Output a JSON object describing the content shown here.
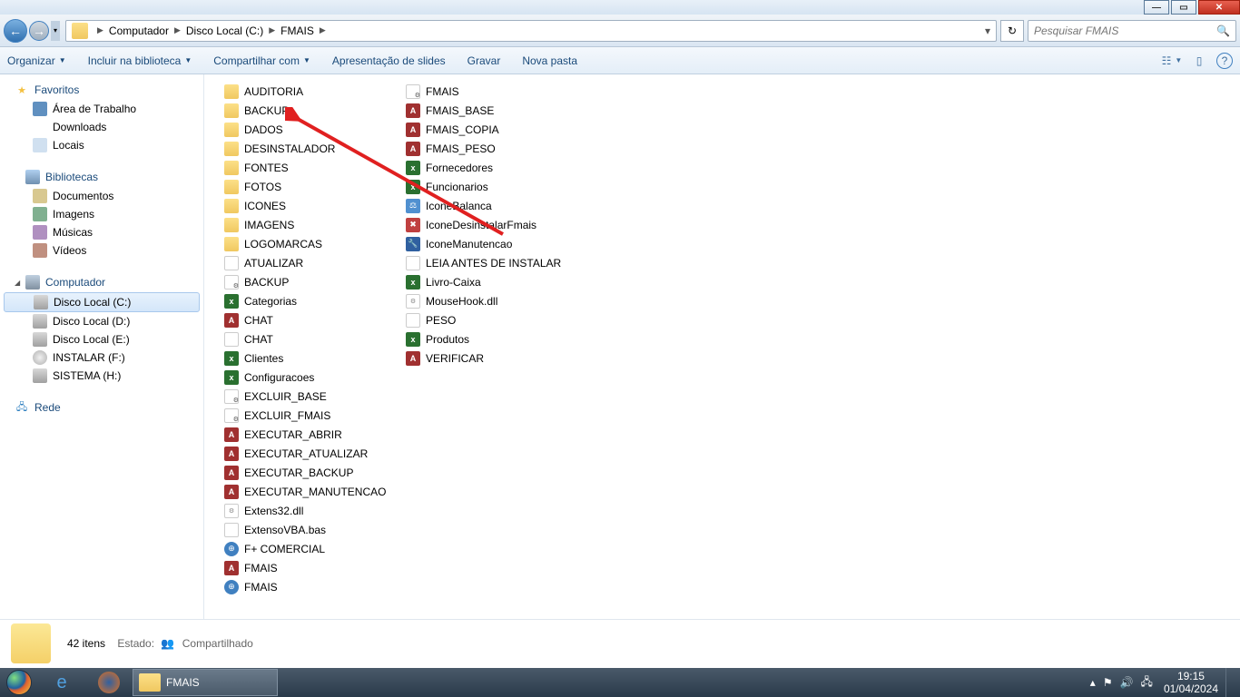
{
  "window": {
    "min": "—",
    "max": "▭",
    "close": "✕"
  },
  "breadcrumb": {
    "items": [
      "Computador",
      "Disco Local (C:)",
      "FMAIS"
    ],
    "drop": "▾",
    "refresh": "↻"
  },
  "search": {
    "placeholder": "Pesquisar FMAIS",
    "icon": "🔍"
  },
  "toolbar": {
    "organizar": "Organizar",
    "incluir": "Incluir na biblioteca",
    "compartilhar": "Compartilhar com",
    "apresentacao": "Apresentação de slides",
    "gravar": "Gravar",
    "novapasta": "Nova pasta",
    "view": "☷",
    "preview": "▯",
    "help": "?"
  },
  "sidebar": {
    "favoritos": {
      "label": "Favoritos",
      "items": [
        {
          "label": "Área de Trabalho",
          "ic": "ic-desk"
        },
        {
          "label": "Downloads",
          "ic": "ic-dl"
        },
        {
          "label": "Locais",
          "ic": "ic-loc"
        }
      ]
    },
    "bibliotecas": {
      "label": "Bibliotecas",
      "items": [
        {
          "label": "Documentos",
          "ic": "ic-doc"
        },
        {
          "label": "Imagens",
          "ic": "ic-img"
        },
        {
          "label": "Músicas",
          "ic": "ic-mus"
        },
        {
          "label": "Vídeos",
          "ic": "ic-vid"
        }
      ]
    },
    "computador": {
      "label": "Computador",
      "items": [
        {
          "label": "Disco Local (C:)",
          "ic": "ic-hdd",
          "sel": true
        },
        {
          "label": "Disco Local (D:)",
          "ic": "ic-hdd"
        },
        {
          "label": "Disco Local (E:)",
          "ic": "ic-hdd"
        },
        {
          "label": "INSTALAR (F:)",
          "ic": "ic-cd"
        },
        {
          "label": "SISTEMA (H:)",
          "ic": "ic-hdd"
        }
      ]
    },
    "rede": {
      "label": "Rede"
    }
  },
  "files": {
    "col1": [
      {
        "n": "AUDITORIA",
        "t": "f-folder"
      },
      {
        "n": "BACKUP",
        "t": "f-folder"
      },
      {
        "n": "DADOS",
        "t": "f-folder"
      },
      {
        "n": "DESINSTALADOR",
        "t": "f-folder"
      },
      {
        "n": "FONTES",
        "t": "f-folder"
      },
      {
        "n": "FOTOS",
        "t": "f-folder"
      },
      {
        "n": "ICONES",
        "t": "f-folder"
      },
      {
        "n": "IMAGENS",
        "t": "f-folder"
      },
      {
        "n": "LOGOMARCAS",
        "t": "f-folder"
      },
      {
        "n": "ATUALIZAR",
        "t": "f-txt"
      },
      {
        "n": "BACKUP",
        "t": "f-bat"
      },
      {
        "n": "Categorias",
        "t": "f-xls",
        "l": "x"
      },
      {
        "n": "CHAT",
        "t": "f-acc",
        "l": "A"
      },
      {
        "n": "CHAT",
        "t": "f-txt"
      },
      {
        "n": "Clientes",
        "t": "f-xls",
        "l": "x"
      },
      {
        "n": "Configuracoes",
        "t": "f-xls",
        "l": "x"
      },
      {
        "n": "EXCLUIR_BASE",
        "t": "f-bat"
      },
      {
        "n": "EXCLUIR_FMAIS",
        "t": "f-bat"
      },
      {
        "n": "EXECUTAR_ABRIR",
        "t": "f-acc",
        "l": "A"
      },
      {
        "n": "EXECUTAR_ATUALIZAR",
        "t": "f-acc",
        "l": "A"
      },
      {
        "n": "EXECUTAR_BACKUP",
        "t": "f-acc",
        "l": "A"
      },
      {
        "n": "EXECUTAR_MANUTENCAO",
        "t": "f-acc",
        "l": "A"
      },
      {
        "n": "Extens32.dll",
        "t": "f-dll"
      },
      {
        "n": "ExtensoVBA.bas",
        "t": "f-txt"
      },
      {
        "n": "F+ COMERCIAL",
        "t": "f-app",
        "l": "⊕"
      },
      {
        "n": "FMAIS",
        "t": "f-acc",
        "l": "A"
      },
      {
        "n": "FMAIS",
        "t": "f-app",
        "l": "⊕"
      }
    ],
    "col2": [
      {
        "n": "FMAIS",
        "t": "f-bat"
      },
      {
        "n": "FMAIS_BASE",
        "t": "f-acc",
        "l": "A"
      },
      {
        "n": "FMAIS_COPIA",
        "t": "f-acc",
        "l": "A"
      },
      {
        "n": "FMAIS_PESO",
        "t": "f-acc",
        "l": "A"
      },
      {
        "n": "Fornecedores",
        "t": "f-xls",
        "l": "x"
      },
      {
        "n": "Funcionarios",
        "t": "f-xls",
        "l": "x"
      },
      {
        "n": "IconeBalanca",
        "t": "f-bal",
        "l": "⚖"
      },
      {
        "n": "IconeDesinstalarFmais",
        "t": "f-uni",
        "l": "✖"
      },
      {
        "n": "IconeManutencao",
        "t": "f-mnt",
        "l": "🔧"
      },
      {
        "n": "LEIA ANTES DE INSTALAR",
        "t": "f-txt"
      },
      {
        "n": "Livro-Caixa",
        "t": "f-xls",
        "l": "x"
      },
      {
        "n": "MouseHook.dll",
        "t": "f-dll"
      },
      {
        "n": "PESO",
        "t": "f-txt"
      },
      {
        "n": "Produtos",
        "t": "f-xls",
        "l": "x"
      },
      {
        "n": "VERIFICAR",
        "t": "f-acc",
        "l": "A"
      }
    ]
  },
  "status": {
    "count": "42 itens",
    "estado_lbl": "Estado:",
    "estado_val": "Compartilhado"
  },
  "taskbar": {
    "app": "FMAIS",
    "time": "19:15",
    "date": "01/04/2024",
    "tray_up": "▴",
    "tray_flag": "⚑",
    "tray_vol": "🔊",
    "tray_net": "🖧"
  }
}
